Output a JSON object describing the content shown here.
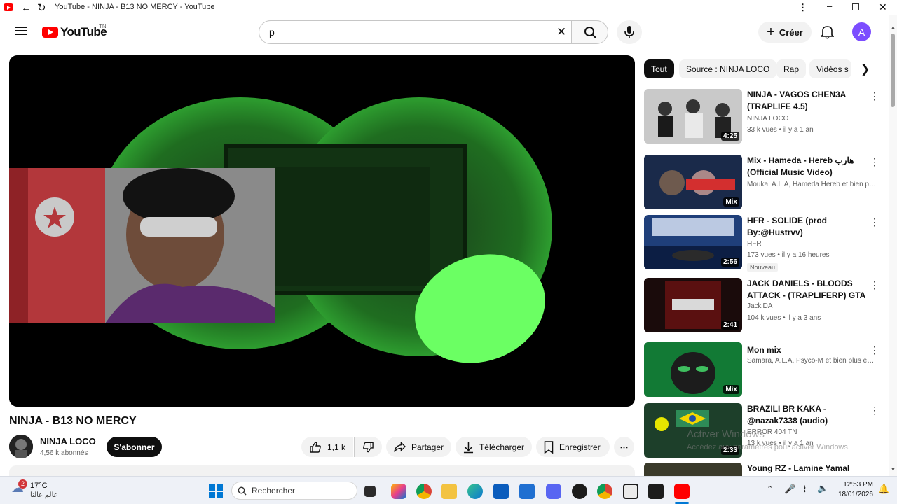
{
  "titlebar": {
    "title": "YouTube - NINJA - B13 NO MERCY - YouTube"
  },
  "masthead": {
    "logo": "YouTube",
    "country": "TN",
    "search_value": "p",
    "create_label": "Créer",
    "avatar_letter": "A"
  },
  "video": {
    "title": "NINJA - B13 NO MERCY",
    "channel": "NINJA LOCO",
    "subscribers": "4,56 k abonnés",
    "subscribe_label": "S'abonner",
    "likes": "1,1 k",
    "share_label": "Partager",
    "download_label": "Télécharger",
    "save_label": "Enregistrer"
  },
  "chips": [
    "Tout",
    "Source : NINJA LOCO",
    "Rap",
    "Vidéos s"
  ],
  "recommendations": [
    {
      "title": "NINJA - VAGOS CHEN3A (TRAPLIFE 4.5)",
      "channel": "NINJA LOCO",
      "stats": "33 k vues • il y a 1 an",
      "duration": "4:25"
    },
    {
      "title": "Mix - Hameda - Hereb هارب (Official Music Video)",
      "channel": "Mouka, A.L.A, Hameda Hereb et bien plu...",
      "stats": "",
      "duration": "Mix"
    },
    {
      "title": "HFR - SOLIDE (prod By:@Hustrvv)",
      "channel": "HFR",
      "stats": "173 vues • il y a 16 heures",
      "duration": "2:56",
      "badge": "Nouveau"
    },
    {
      "title": "JACK DANIELS - BLOODS ATTACK - (TRAPLIFERP) GTA ...",
      "channel": "Jack'DA",
      "stats": "104 k vues • il y a 3 ans",
      "duration": "2:41"
    },
    {
      "title": "Mon mix",
      "channel": "Samara, A.L.A, Psyco-M et bien plus enc...",
      "stats": "",
      "duration": "Mix"
    },
    {
      "title": "BRAZILI BR KAKA - @nazak7338 (audio) (OFFICIE...",
      "channel": "ERROR 404 TN",
      "stats": "13 k vues • il y a 1 an",
      "duration": "2:33"
    },
    {
      "title": "Young RZ - Lamine Yamal",
      "channel": "",
      "stats": "",
      "duration": ""
    }
  ],
  "watermark": {
    "line1": "Activer Windows",
    "line2": "Accédez aux paramètres pour activer Windows."
  },
  "taskbar": {
    "weather_temp": "17°C",
    "weather_text": "عالم عالنا",
    "weather_badge": "2",
    "search_label": "Rechercher",
    "time": "12:53 PM",
    "date": "18/01/2026"
  },
  "colors": {
    "accent": "#ff0000",
    "dark": "#0f0f0f",
    "night_green": "#39c93a"
  }
}
